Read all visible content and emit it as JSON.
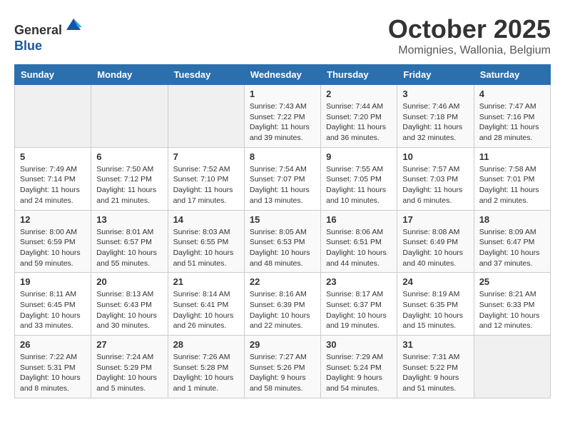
{
  "header": {
    "logo_line1": "General",
    "logo_line2": "Blue",
    "month": "October 2025",
    "location": "Momignies, Wallonia, Belgium"
  },
  "weekdays": [
    "Sunday",
    "Monday",
    "Tuesday",
    "Wednesday",
    "Thursday",
    "Friday",
    "Saturday"
  ],
  "weeks": [
    [
      {
        "day": "",
        "text": ""
      },
      {
        "day": "",
        "text": ""
      },
      {
        "day": "",
        "text": ""
      },
      {
        "day": "1",
        "text": "Sunrise: 7:43 AM\nSunset: 7:22 PM\nDaylight: 11 hours and 39 minutes."
      },
      {
        "day": "2",
        "text": "Sunrise: 7:44 AM\nSunset: 7:20 PM\nDaylight: 11 hours and 36 minutes."
      },
      {
        "day": "3",
        "text": "Sunrise: 7:46 AM\nSunset: 7:18 PM\nDaylight: 11 hours and 32 minutes."
      },
      {
        "day": "4",
        "text": "Sunrise: 7:47 AM\nSunset: 7:16 PM\nDaylight: 11 hours and 28 minutes."
      }
    ],
    [
      {
        "day": "5",
        "text": "Sunrise: 7:49 AM\nSunset: 7:14 PM\nDaylight: 11 hours and 24 minutes."
      },
      {
        "day": "6",
        "text": "Sunrise: 7:50 AM\nSunset: 7:12 PM\nDaylight: 11 hours and 21 minutes."
      },
      {
        "day": "7",
        "text": "Sunrise: 7:52 AM\nSunset: 7:10 PM\nDaylight: 11 hours and 17 minutes."
      },
      {
        "day": "8",
        "text": "Sunrise: 7:54 AM\nSunset: 7:07 PM\nDaylight: 11 hours and 13 minutes."
      },
      {
        "day": "9",
        "text": "Sunrise: 7:55 AM\nSunset: 7:05 PM\nDaylight: 11 hours and 10 minutes."
      },
      {
        "day": "10",
        "text": "Sunrise: 7:57 AM\nSunset: 7:03 PM\nDaylight: 11 hours and 6 minutes."
      },
      {
        "day": "11",
        "text": "Sunrise: 7:58 AM\nSunset: 7:01 PM\nDaylight: 11 hours and 2 minutes."
      }
    ],
    [
      {
        "day": "12",
        "text": "Sunrise: 8:00 AM\nSunset: 6:59 PM\nDaylight: 10 hours and 59 minutes."
      },
      {
        "day": "13",
        "text": "Sunrise: 8:01 AM\nSunset: 6:57 PM\nDaylight: 10 hours and 55 minutes."
      },
      {
        "day": "14",
        "text": "Sunrise: 8:03 AM\nSunset: 6:55 PM\nDaylight: 10 hours and 51 minutes."
      },
      {
        "day": "15",
        "text": "Sunrise: 8:05 AM\nSunset: 6:53 PM\nDaylight: 10 hours and 48 minutes."
      },
      {
        "day": "16",
        "text": "Sunrise: 8:06 AM\nSunset: 6:51 PM\nDaylight: 10 hours and 44 minutes."
      },
      {
        "day": "17",
        "text": "Sunrise: 8:08 AM\nSunset: 6:49 PM\nDaylight: 10 hours and 40 minutes."
      },
      {
        "day": "18",
        "text": "Sunrise: 8:09 AM\nSunset: 6:47 PM\nDaylight: 10 hours and 37 minutes."
      }
    ],
    [
      {
        "day": "19",
        "text": "Sunrise: 8:11 AM\nSunset: 6:45 PM\nDaylight: 10 hours and 33 minutes."
      },
      {
        "day": "20",
        "text": "Sunrise: 8:13 AM\nSunset: 6:43 PM\nDaylight: 10 hours and 30 minutes."
      },
      {
        "day": "21",
        "text": "Sunrise: 8:14 AM\nSunset: 6:41 PM\nDaylight: 10 hours and 26 minutes."
      },
      {
        "day": "22",
        "text": "Sunrise: 8:16 AM\nSunset: 6:39 PM\nDaylight: 10 hours and 22 minutes."
      },
      {
        "day": "23",
        "text": "Sunrise: 8:17 AM\nSunset: 6:37 PM\nDaylight: 10 hours and 19 minutes."
      },
      {
        "day": "24",
        "text": "Sunrise: 8:19 AM\nSunset: 6:35 PM\nDaylight: 10 hours and 15 minutes."
      },
      {
        "day": "25",
        "text": "Sunrise: 8:21 AM\nSunset: 6:33 PM\nDaylight: 10 hours and 12 minutes."
      }
    ],
    [
      {
        "day": "26",
        "text": "Sunrise: 7:22 AM\nSunset: 5:31 PM\nDaylight: 10 hours and 8 minutes."
      },
      {
        "day": "27",
        "text": "Sunrise: 7:24 AM\nSunset: 5:29 PM\nDaylight: 10 hours and 5 minutes."
      },
      {
        "day": "28",
        "text": "Sunrise: 7:26 AM\nSunset: 5:28 PM\nDaylight: 10 hours and 1 minute."
      },
      {
        "day": "29",
        "text": "Sunrise: 7:27 AM\nSunset: 5:26 PM\nDaylight: 9 hours and 58 minutes."
      },
      {
        "day": "30",
        "text": "Sunrise: 7:29 AM\nSunset: 5:24 PM\nDaylight: 9 hours and 54 minutes."
      },
      {
        "day": "31",
        "text": "Sunrise: 7:31 AM\nSunset: 5:22 PM\nDaylight: 9 hours and 51 minutes."
      },
      {
        "day": "",
        "text": ""
      }
    ]
  ]
}
